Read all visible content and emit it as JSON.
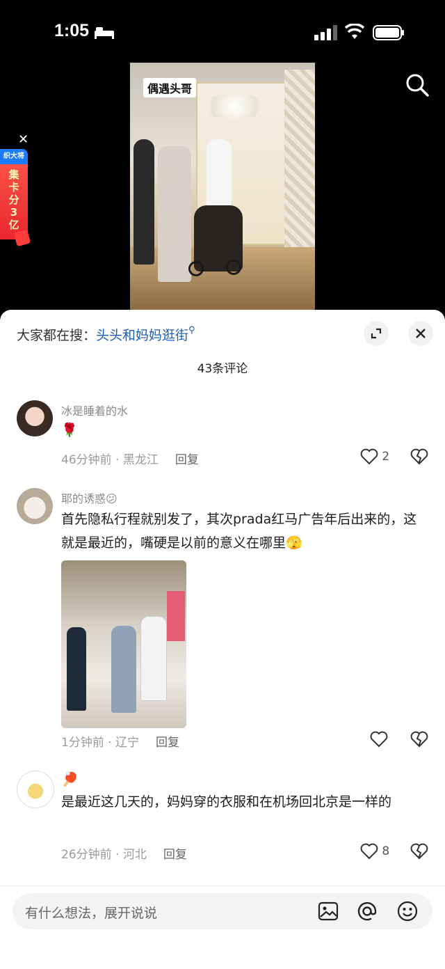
{
  "status_bar": {
    "time": "1:05"
  },
  "video": {
    "caption": "偶遇头哥"
  },
  "promo": {
    "head": "织大将",
    "text": "集卡分3亿"
  },
  "sheet": {
    "trending_prefix": "大家都在搜：",
    "trending_keyword": "头头和妈妈逛街",
    "comment_count": "43条评论"
  },
  "comments": [
    {
      "username": "冰是睡着的水",
      "text": "🌹",
      "time_location": "46分钟前 · 黑龙江",
      "reply": "回复",
      "likes": "2"
    },
    {
      "username": "耶的诱惑😕",
      "text": "首先隐私行程就别发了，其次prada红马广告年后出来的，这就是最近的，嘴硬是以前的意义在哪里🫣",
      "time_location": "1分钟前 · 辽宁",
      "reply": "回复",
      "likes": ""
    },
    {
      "username": "🏓",
      "text": "是最近这几天的，妈妈穿的衣服和在机场回北京是一样的",
      "time_location": "26分钟前 · 河北",
      "reply": "回复",
      "likes": "8"
    }
  ],
  "input": {
    "placeholder": "有什么想法，展开说说"
  },
  "colors": {
    "keyword": "#1b5fb5",
    "background": "#000000",
    "sheet": "#ffffff"
  }
}
